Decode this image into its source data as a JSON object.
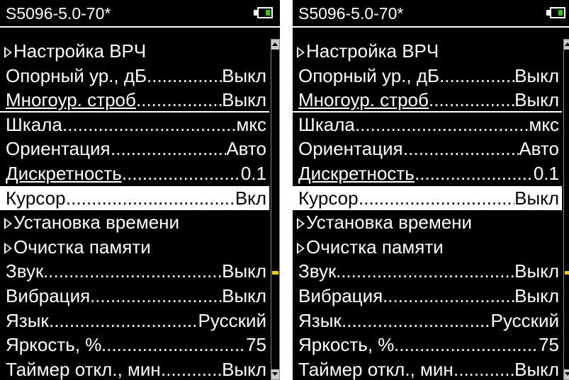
{
  "colors": {
    "background": "#000000",
    "text": "#ffffff",
    "highlight": "#ffffff",
    "battery": "#28d000",
    "scroll_thumb": "#f0d000"
  },
  "screens": [
    {
      "title": "S5096-5.0-70*",
      "items": [
        {
          "label": "Настройка ВРЧ",
          "value": ""
        },
        {
          "label": "Опорный ур., дБ",
          "value": "Выкл"
        },
        {
          "label": "Многоур. строб",
          "value": "Выкл"
        },
        {
          "label": "Шкала",
          "value": "мкс"
        },
        {
          "label": "Ориентация",
          "value": "Авто"
        },
        {
          "label": "Дискретность",
          "value": "0.1"
        },
        {
          "label": "Курсор",
          "value": "Вкл"
        },
        {
          "label": "Установка времени",
          "value": ""
        },
        {
          "label": "Очистка памяти",
          "value": ""
        },
        {
          "label": "Звук",
          "value": "Выкл"
        },
        {
          "label": "Вибрация",
          "value": "Выкл"
        },
        {
          "label": "Язык",
          "value": "Русский"
        },
        {
          "label": "Яркость, %",
          "value": "75"
        },
        {
          "label": "Таймер откл., мин",
          "value": "Выкл"
        }
      ]
    },
    {
      "title": "S5096-5.0-70*",
      "items": [
        {
          "label": "Настройка ВРЧ",
          "value": ""
        },
        {
          "label": "Опорный ур., дБ",
          "value": "Выкл"
        },
        {
          "label": "Многоур. строб",
          "value": "Выкл"
        },
        {
          "label": "Шкала",
          "value": "мкс"
        },
        {
          "label": "Ориентация",
          "value": "Авто"
        },
        {
          "label": "Дискретность",
          "value": "0.1"
        },
        {
          "label": "Курсор",
          "value": "Выкл"
        },
        {
          "label": "Установка времени",
          "value": ""
        },
        {
          "label": "Очистка памяти",
          "value": ""
        },
        {
          "label": "Звук",
          "value": "Выкл"
        },
        {
          "label": "Вибрация",
          "value": "Выкл"
        },
        {
          "label": "Язык",
          "value": "Русский"
        },
        {
          "label": "Яркость, %",
          "value": "75"
        },
        {
          "label": "Таймер откл., мин",
          "value": "Выкл"
        }
      ]
    }
  ]
}
